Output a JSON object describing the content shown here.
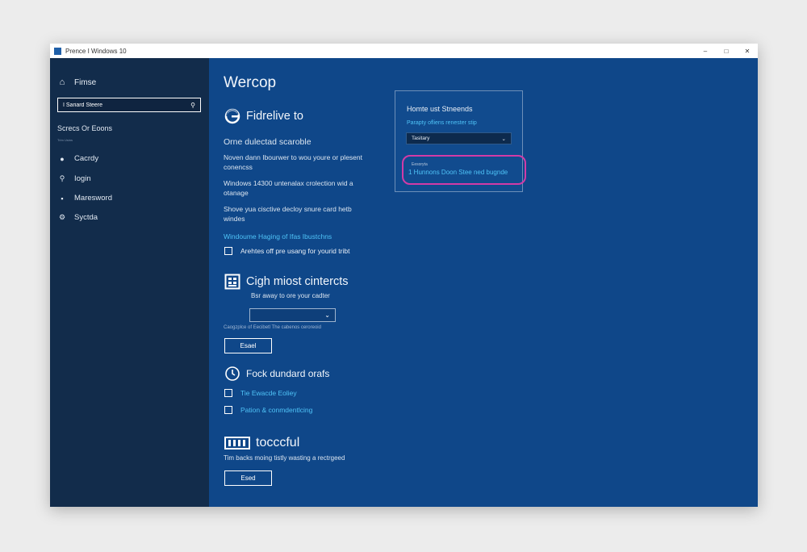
{
  "window": {
    "title": "Prence I Windows 10",
    "controls": {
      "minimize": "–",
      "maximize": "□",
      "close": "✕"
    }
  },
  "sidebar": {
    "home": {
      "icon": "home-icon",
      "label": "Fimse"
    },
    "search": {
      "value": "I Sariard Steere",
      "icon": "search-icon"
    },
    "header": "Screcs Or Eoons",
    "subheader": "Trim Usins",
    "items": [
      {
        "icon": "person-icon",
        "label": "Cacrdy"
      },
      {
        "icon": "location-icon",
        "label": "Iogin"
      },
      {
        "icon": "keyboard-icon",
        "label": "Maresword"
      },
      {
        "icon": "gear-icon",
        "label": "Syctda"
      }
    ]
  },
  "main": {
    "title": "Wercop",
    "section1": {
      "icon": "edge-icon",
      "heading": "Fidrelive to",
      "subheading": "Orne dulectad scaroble",
      "para1_line1": "Noven dann Ibourwer to wou youre or plesent",
      "para1_line2": "conencss",
      "para2_line1": "Windows 14300 untenalax crolection wid a",
      "para2_line2": "otanage",
      "para3_line1": "Shove yua cisctive decloy snure card hetb",
      "para3_line2": "windes",
      "link": "Windoume Haging of Ifas Ibustchns",
      "checkbox_label": "Arehtes off pre usang for yourid tribt"
    },
    "section2": {
      "icon": "calculator-icon",
      "heading": "Cigh miost cintercts",
      "subheading": "Bsr away to ore your cadter",
      "select_icon": "chevron-down-icon",
      "caption": "Caogzplce of Eecibetl The cabenos ceroreoid",
      "button": "Esael"
    },
    "section3": {
      "icon": "clock-icon",
      "heading": "Fock dundard orafs",
      "links": [
        "Tie Ewacde Eoliey",
        "Pation & conmdentlcing"
      ]
    },
    "section4": {
      "icon": "keyboard-icon",
      "heading": "tocccful",
      "text": "Tim backs moing tistly wasting a rectrgeed",
      "button": "Esed"
    }
  },
  "panel": {
    "title": "Homte ust Stneends",
    "link": "Parapty ofliens renester stip",
    "select_value": "Tasitary",
    "select_icon": "chevron-down-icon",
    "highlight_label": "Eesoryta",
    "highlight_text": "1 Hunnons Doon Stee ned bugnde"
  }
}
